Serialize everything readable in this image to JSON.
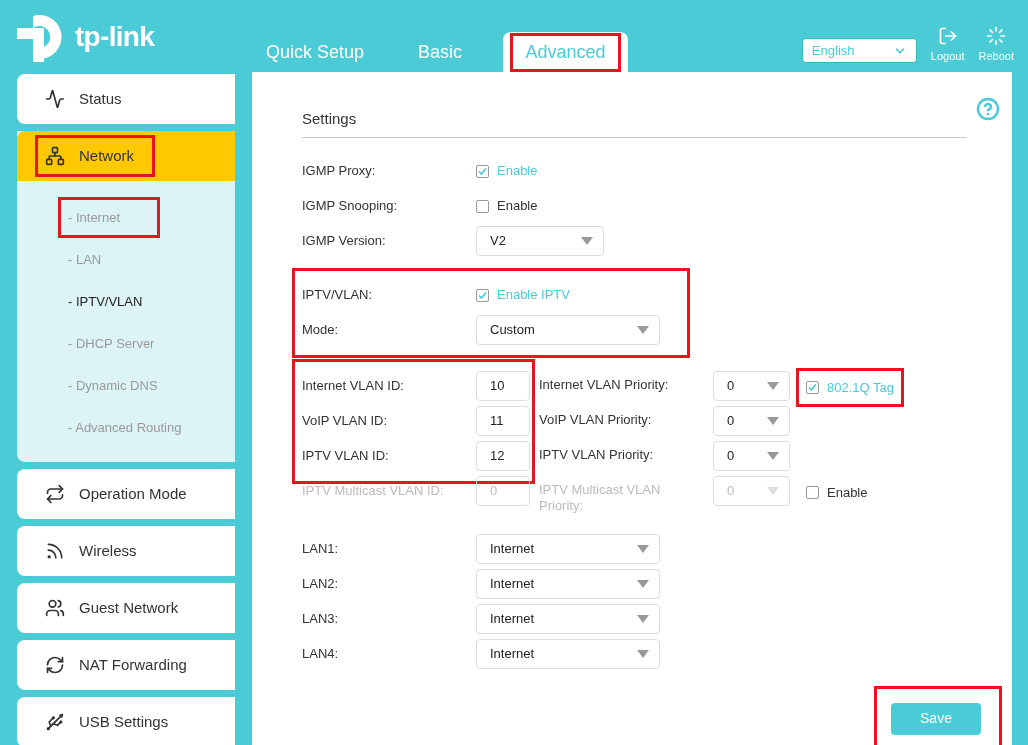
{
  "brand": {
    "name": "tp-link"
  },
  "tabs": [
    {
      "label": "Quick Setup",
      "selected": false,
      "highlighted": false
    },
    {
      "label": "Basic",
      "selected": false,
      "highlighted": false
    },
    {
      "label": "Advanced",
      "selected": true,
      "highlighted": true
    }
  ],
  "language": {
    "value": "English"
  },
  "header_buttons": [
    {
      "label": "Logout",
      "kind": "logout"
    },
    {
      "label": "Reboot",
      "kind": "reboot"
    }
  ],
  "sidebar": {
    "items": [
      {
        "label": "Status",
        "kind": "status",
        "selected": false,
        "highlighted": false
      },
      {
        "label": "Network",
        "kind": "network",
        "selected": true,
        "highlighted": true,
        "expanded": true,
        "children": [
          {
            "label": "- Internet",
            "selected": false,
            "highlighted": true
          },
          {
            "label": "- LAN",
            "selected": false,
            "highlighted": false
          },
          {
            "label": "- IPTV/VLAN",
            "selected": true,
            "highlighted": false
          },
          {
            "label": "- DHCP Server",
            "selected": false,
            "highlighted": false
          },
          {
            "label": "- Dynamic DNS",
            "selected": false,
            "highlighted": false
          },
          {
            "label": "- Advanced Routing",
            "selected": false,
            "highlighted": false
          }
        ]
      },
      {
        "label": "Operation Mode",
        "kind": "mode",
        "selected": false,
        "highlighted": false
      },
      {
        "label": "Wireless",
        "kind": "wireless",
        "selected": false,
        "highlighted": false
      },
      {
        "label": "Guest Network",
        "kind": "guest",
        "selected": false,
        "highlighted": false
      },
      {
        "label": "NAT Forwarding",
        "kind": "nat",
        "selected": false,
        "highlighted": false
      },
      {
        "label": "USB Settings",
        "kind": "usb",
        "selected": false,
        "highlighted": false
      }
    ]
  },
  "section_title": "Settings",
  "igmp": [
    {
      "label": "IGMP Proxy:",
      "kind": "checkbox",
      "checked": true,
      "text": "Enable"
    },
    {
      "label": "IGMP Snooping:",
      "kind": "checkbox",
      "checked": false,
      "text": "Enable"
    },
    {
      "label": "IGMP Version:",
      "kind": "select",
      "value": "V2"
    }
  ],
  "iptv": {
    "highlighted": true,
    "rows": [
      {
        "label": "IPTV/VLAN:",
        "kind": "checkbox",
        "checked": true,
        "text": "Enable IPTV"
      },
      {
        "label": "Mode:",
        "kind": "select",
        "value": "Custom"
      }
    ]
  },
  "vlan_ids_highlighted": true,
  "vlans": [
    {
      "label": "Internet VLAN ID:",
      "value": "10",
      "priority_label": "Internet VLAN Priority:",
      "priority": "0",
      "disabled": false,
      "tag": {
        "text": "802.1Q Tag",
        "checked": true,
        "highlighted": true
      }
    },
    {
      "label": "VoIP VLAN ID:",
      "value": "11",
      "priority_label": "VoIP VLAN Priority:",
      "priority": "0",
      "disabled": false
    },
    {
      "label": "IPTV VLAN ID:",
      "value": "12",
      "priority_label": "IPTV VLAN Priority:",
      "priority": "0",
      "disabled": false
    },
    {
      "label": "IPTV Multicast VLAN ID:",
      "value": "0",
      "priority_label": "IPTV Multicast VLAN Priority:",
      "priority": "0",
      "disabled": true,
      "tag": {
        "text": "Enable",
        "checked": false,
        "highlighted": false
      }
    }
  ],
  "lans": [
    {
      "label": "LAN1:",
      "value": "Internet"
    },
    {
      "label": "LAN2:",
      "value": "Internet"
    },
    {
      "label": "LAN3:",
      "value": "Internet"
    },
    {
      "label": "LAN4:",
      "value": "Internet"
    }
  ],
  "save": {
    "label": "Save",
    "highlighted": true
  }
}
